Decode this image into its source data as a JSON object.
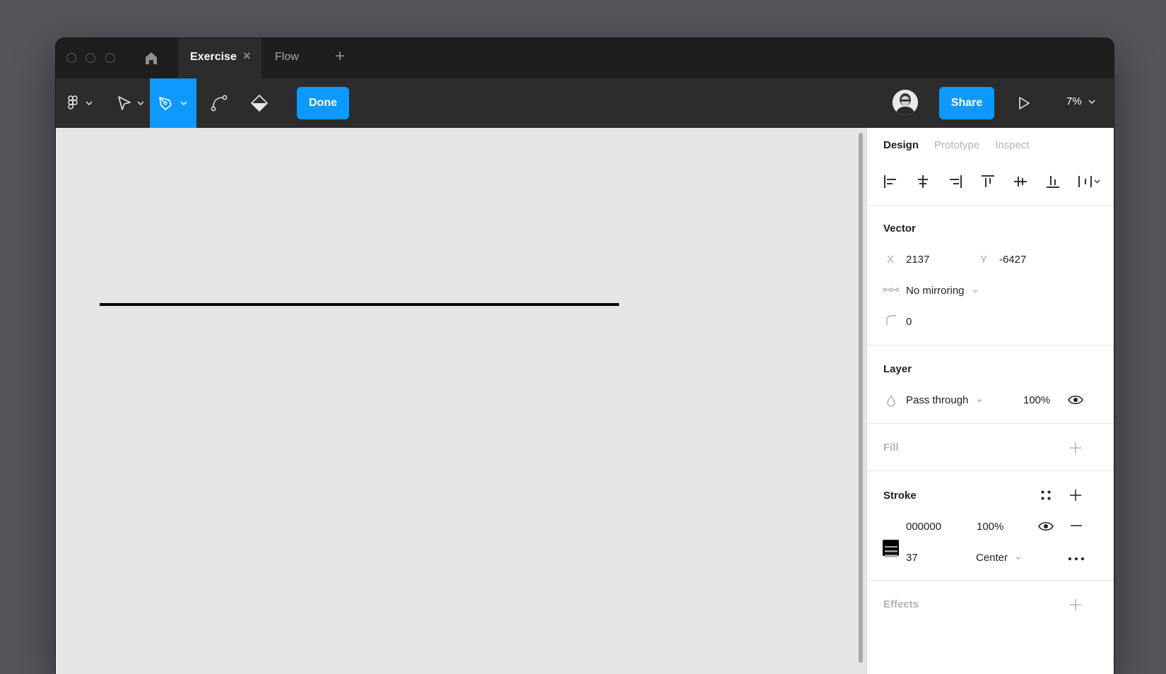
{
  "tabs": [
    {
      "label": "Exercise",
      "active": true
    },
    {
      "label": "Flow",
      "active": false
    }
  ],
  "tab_add": "+",
  "toolbar": {
    "done_label": "Done",
    "share_label": "Share",
    "zoom": "7%"
  },
  "colors": {
    "accent": "#0d99ff",
    "titlebar": "#1e1e1e",
    "toolbar": "#2c2c2c",
    "canvas": "#e5e5e5",
    "stroke": "#000000"
  },
  "panel": {
    "tabs": [
      "Design",
      "Prototype",
      "Inspect"
    ],
    "vector": {
      "title": "Vector",
      "x_label": "X",
      "x_value": "2137",
      "y_label": "Y",
      "y_value": "-6427",
      "mirroring": "No mirroring",
      "corner_radius": "0"
    },
    "layer": {
      "title": "Layer",
      "blend_mode": "Pass through",
      "opacity": "100%"
    },
    "fill": {
      "title": "Fill"
    },
    "stroke": {
      "title": "Stroke",
      "color_hex": "000000",
      "opacity": "100%",
      "weight": "37",
      "position": "Center"
    },
    "effects": {
      "title": "Effects"
    }
  },
  "icons": [
    "home-icon",
    "figma-menu-icon",
    "move-tool-icon",
    "pen-tool-icon",
    "bend-tool-icon",
    "paint-bucket-icon",
    "play-icon",
    "eye-icon",
    "plus-icon",
    "minus-icon",
    "more-icon"
  ]
}
